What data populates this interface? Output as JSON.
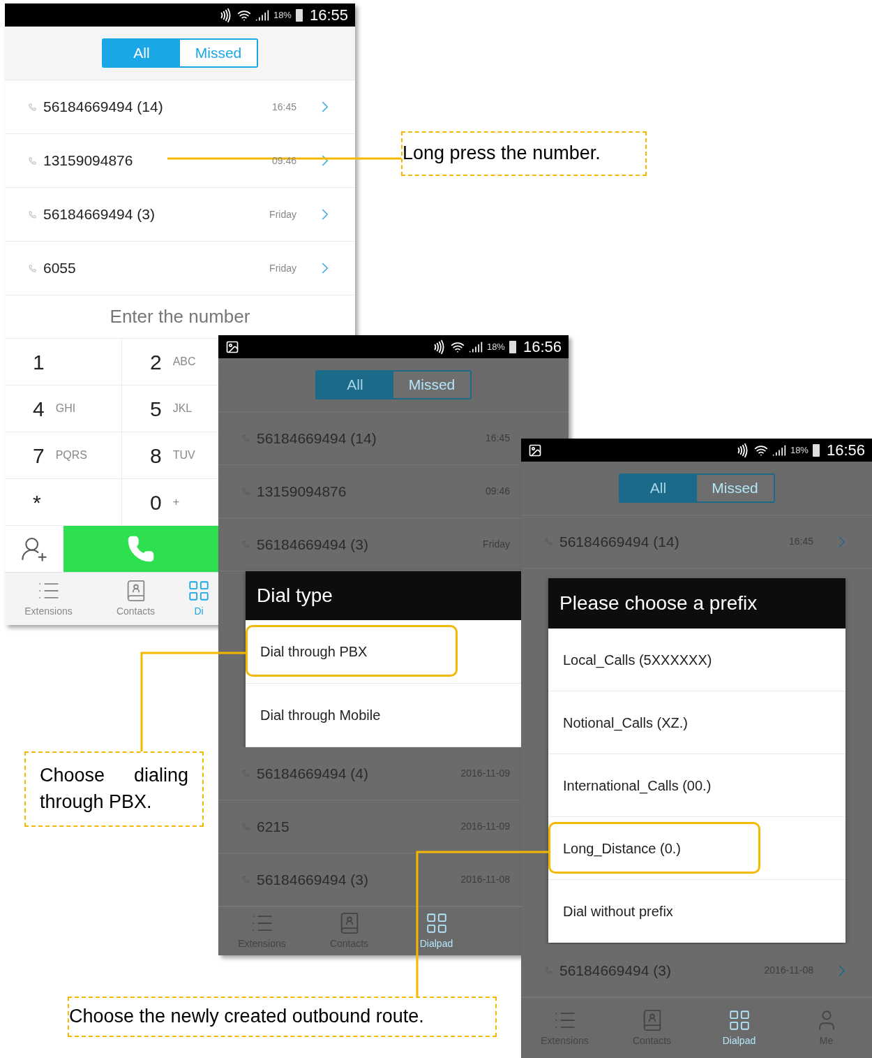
{
  "screens": [
    {
      "dimmed": false,
      "status_bar": {
        "notification": false,
        "battery": "18%",
        "time": "16:55"
      },
      "filter_tabs": [
        {
          "label": "All",
          "selected": true
        },
        {
          "label": "Missed",
          "selected": false
        }
      ],
      "calls": [
        {
          "number": "56184669494 (14)",
          "time": "16:45"
        },
        {
          "number": "13159094876",
          "time": "09:46"
        },
        {
          "number": "56184669494 (3)",
          "time": "Friday"
        },
        {
          "number": "6055",
          "time": "Friday"
        }
      ],
      "number_field": {
        "placeholder": "Enter the number"
      },
      "keypad": [
        {
          "digit": "1"
        },
        {
          "digit": "2",
          "letters": "ABC"
        },
        {
          "digit": "4",
          "letters": "GHI"
        },
        {
          "digit": "5",
          "letters": "JKL"
        },
        {
          "digit": "7",
          "letters": "PQRS"
        },
        {
          "digit": "8",
          "letters": "TUV"
        },
        {
          "digit": "*"
        },
        {
          "digit": "0",
          "letters": "+"
        }
      ],
      "nav": [
        {
          "label": "Extensions",
          "selected": false
        },
        {
          "label": "Contacts",
          "selected": false
        },
        {
          "label": "Di",
          "selected": true
        }
      ]
    },
    {
      "dimmed": true,
      "status_bar": {
        "notification": true,
        "battery": "18%",
        "time": "16:56"
      },
      "filter_tabs": [
        {
          "label": "All",
          "selected": true
        },
        {
          "label": "Missed",
          "selected": false
        }
      ],
      "calls": [
        {
          "number": "56184669494 (14)",
          "time": "16:45"
        },
        {
          "number": "13159094876",
          "time": "09:46"
        },
        {
          "number": "56184669494 (3)",
          "time": "Friday"
        },
        {
          "number": "56184669494 (4)",
          "time": "2016-11-09"
        },
        {
          "number": "6215",
          "time": "2016-11-09"
        },
        {
          "number": "56184669494 (3)",
          "time": "2016-11-08"
        }
      ],
      "dialog": {
        "title": "Dial type",
        "options": [
          {
            "label": "Dial through PBX",
            "highlighted": true
          },
          {
            "label": "Dial through Mobile",
            "highlighted": false
          }
        ]
      },
      "nav": [
        {
          "label": "Extensions",
          "selected": false
        },
        {
          "label": "Contacts",
          "selected": false
        },
        {
          "label": "Dialpad",
          "selected": true
        }
      ]
    },
    {
      "dimmed": true,
      "status_bar": {
        "notification": true,
        "battery": "18%",
        "time": "16:56"
      },
      "filter_tabs": [
        {
          "label": "All",
          "selected": true
        },
        {
          "label": "Missed",
          "selected": false
        }
      ],
      "calls": [
        {
          "number": "56184669494 (14)",
          "time": "16:45"
        },
        {
          "number": "56184669494 (3)",
          "time": "2016-11-08"
        }
      ],
      "dialog": {
        "title": "Please choose a prefix",
        "options": [
          {
            "label": "Local_Calls (5XXXXXX)",
            "highlighted": false
          },
          {
            "label": "Notional_Calls (XZ.)",
            "highlighted": false
          },
          {
            "label": "International_Calls (00.)",
            "highlighted": false
          },
          {
            "label": "Long_Distance (0.)",
            "highlighted": true
          },
          {
            "label": "Dial without prefix",
            "highlighted": false
          }
        ]
      },
      "nav": [
        {
          "label": "Extensions",
          "selected": false
        },
        {
          "label": "Contacts",
          "selected": false
        },
        {
          "label": "Dialpad",
          "selected": true
        },
        {
          "label": "Me",
          "selected": false
        }
      ]
    }
  ],
  "callouts": [
    {
      "text": "Long press the number."
    },
    {
      "text": "Choose dialing through PBX."
    },
    {
      "text": "Choose the newly created outbound route."
    }
  ]
}
